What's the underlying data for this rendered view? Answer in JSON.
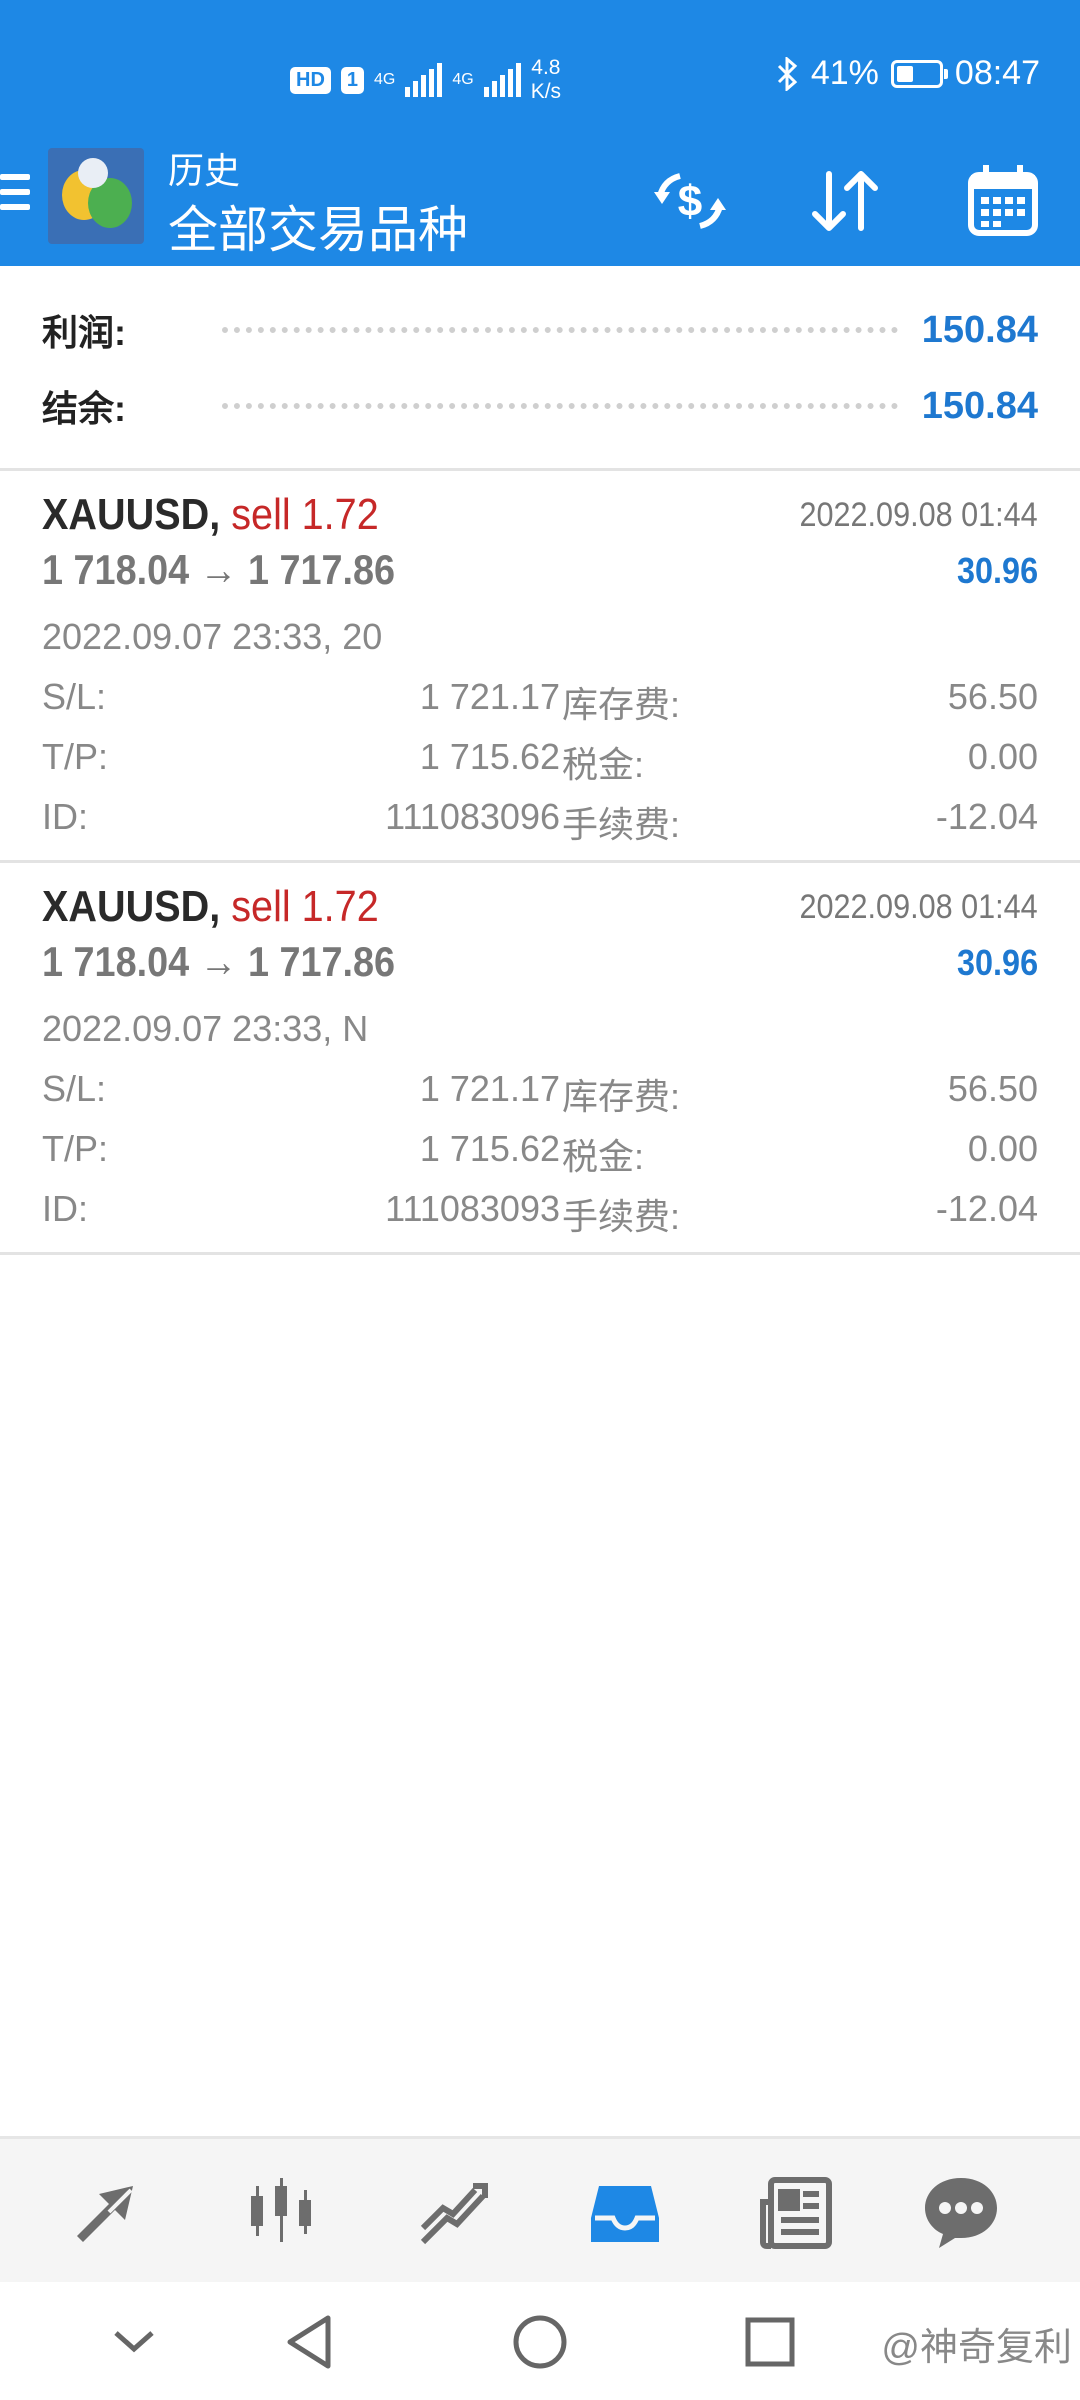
{
  "status_bar": {
    "hd_label": "HD",
    "sim_label": "1",
    "net1": "4G",
    "net2": "4G",
    "speed_value": "4.8",
    "speed_unit": "K/s",
    "battery_percent": "41%",
    "time": "08:47"
  },
  "app_bar": {
    "subtitle": "历史",
    "title": "全部交易品种",
    "icons": [
      "menu-icon",
      "mt4-logo",
      "currency-exchange-icon",
      "sort-icon",
      "calendar-icon"
    ]
  },
  "summary": {
    "profit_label": "利润:",
    "profit_value": "150.84",
    "balance_label": "结余:",
    "balance_value": "150.84"
  },
  "trades": [
    {
      "symbol": "XAUUSD,",
      "side": "sell 1.72",
      "close_time": "2022.09.08 01:44",
      "price_range": "1 718.04 → 1 717.86",
      "profit": "30.96",
      "open_time": "2022.09.07 23:33, 20",
      "sl_label": "S/L:",
      "sl_value": "1 721.17",
      "tp_label": "T/P:",
      "tp_value": "1 715.62",
      "id_label": "ID:",
      "id_value": "111083096",
      "swap_label": "库存费:",
      "swap_value": "56.50",
      "tax_label": "税金:",
      "tax_value": "0.00",
      "fee_label": "手续费:",
      "fee_value": "-12.04"
    },
    {
      "symbol": "XAUUSD,",
      "side": "sell 1.72",
      "close_time": "2022.09.08 01:44",
      "price_range": "1 718.04 → 1 717.86",
      "profit": "30.96",
      "open_time": "2022.09.07 23:33, N",
      "sl_label": "S/L:",
      "sl_value": "1 721.17",
      "tp_label": "T/P:",
      "tp_value": "1 715.62",
      "id_label": "ID:",
      "id_value": "111083093",
      "swap_label": "库存费:",
      "swap_value": "56.50",
      "tax_label": "税金:",
      "tax_value": "0.00",
      "fee_label": "手续费:",
      "fee_value": "-12.04"
    }
  ],
  "bottom_nav": {
    "items": [
      "quotes-icon",
      "chart-icon",
      "trade-icon",
      "history-icon",
      "news-icon",
      "chat-icon"
    ],
    "active": "history-icon"
  },
  "system_nav": {
    "watermark": "@神奇复利"
  },
  "colors": {
    "primary": "#1e88e5",
    "profit_blue": "#1e78d0",
    "sell_red": "#c62828",
    "muted": "#888888"
  }
}
